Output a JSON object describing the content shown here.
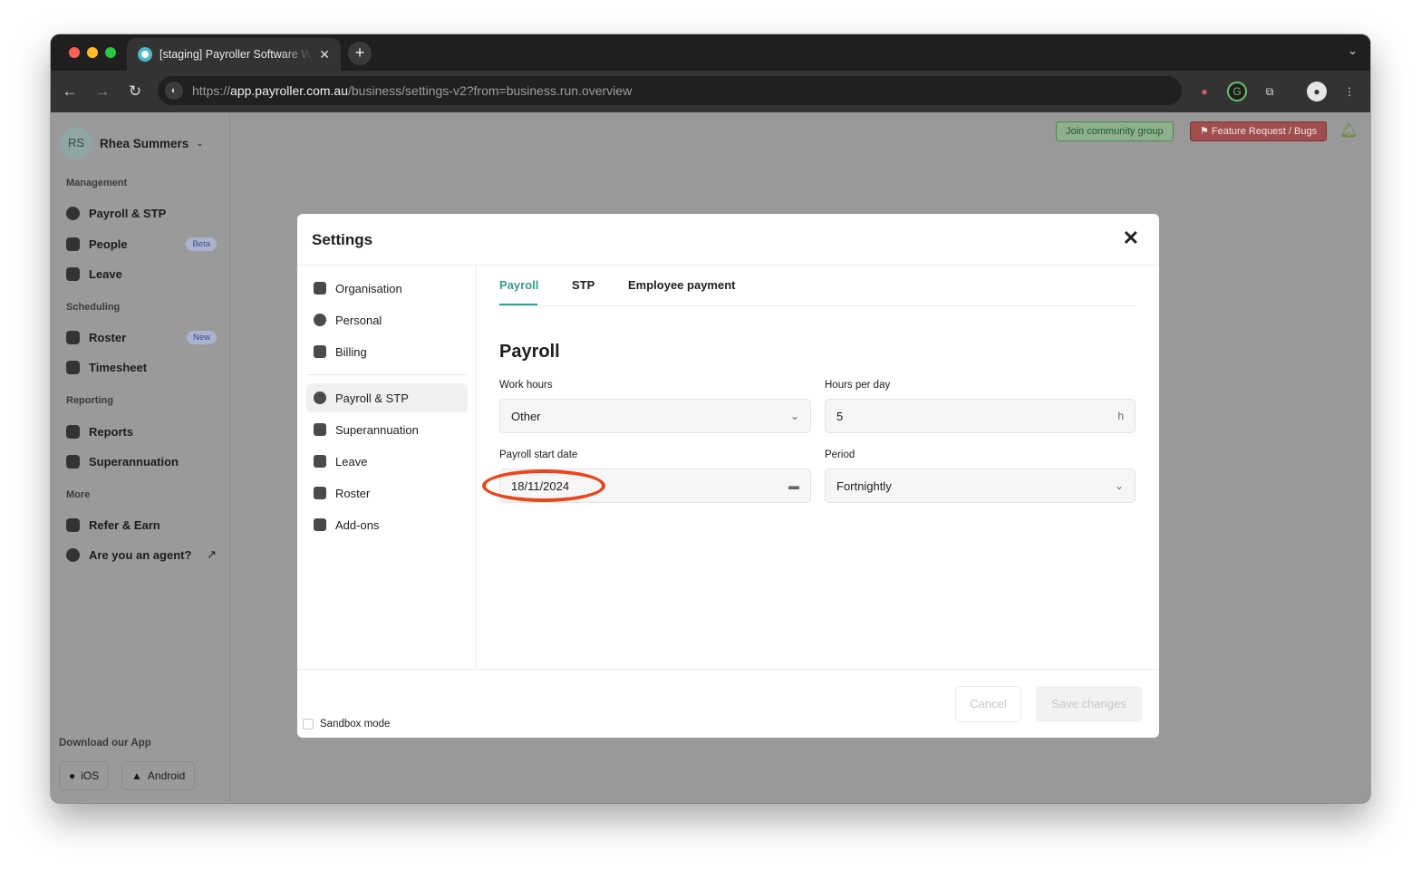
{
  "browser": {
    "tab_title": "[staging] Payroller Software W",
    "url_prefix": "https://",
    "url_host": "app.payroller.com.au",
    "url_path": "/business/settings-v2?from=business.run.overview"
  },
  "user": {
    "initials": "RS",
    "name": "Rhea Summers"
  },
  "sidebar": {
    "management_label": "Management",
    "payroll": "Payroll & STP",
    "people": "People",
    "people_badge": "Beta",
    "leave": "Leave",
    "scheduling_label": "Scheduling",
    "roster": "Roster",
    "roster_badge": "New",
    "timesheet": "Timesheet",
    "reporting_label": "Reporting",
    "reports": "Reports",
    "superannuation": "Superannuation",
    "more_label": "More",
    "refer": "Refer & Earn",
    "agent": "Are you an agent?",
    "download_label": "Download our App",
    "ios": "iOS",
    "android": "Android"
  },
  "topbar": {
    "join": "Join community group",
    "feature": "Feature Request / Bugs"
  },
  "modal": {
    "title": "Settings",
    "nav": {
      "organisation": "Organisation",
      "personal": "Personal",
      "billing": "Billing",
      "payroll": "Payroll & STP",
      "superannuation": "Superannuation",
      "leave": "Leave",
      "roster": "Roster",
      "addons": "Add-ons"
    },
    "tabs": {
      "payroll": "Payroll",
      "stp": "STP",
      "employee_payment": "Employee payment"
    },
    "section_title": "Payroll",
    "work_hours_label": "Work hours",
    "work_hours_value": "Other",
    "hours_per_day_label": "Hours per day",
    "hours_per_day_value": "5",
    "hours_suffix": "h",
    "start_date_label": "Payroll start date",
    "start_date_value": "18/11/2024",
    "period_label": "Period",
    "period_value": "Fortnightly",
    "sandbox_label": "Sandbox mode",
    "cancel": "Cancel",
    "save": "Save changes"
  }
}
